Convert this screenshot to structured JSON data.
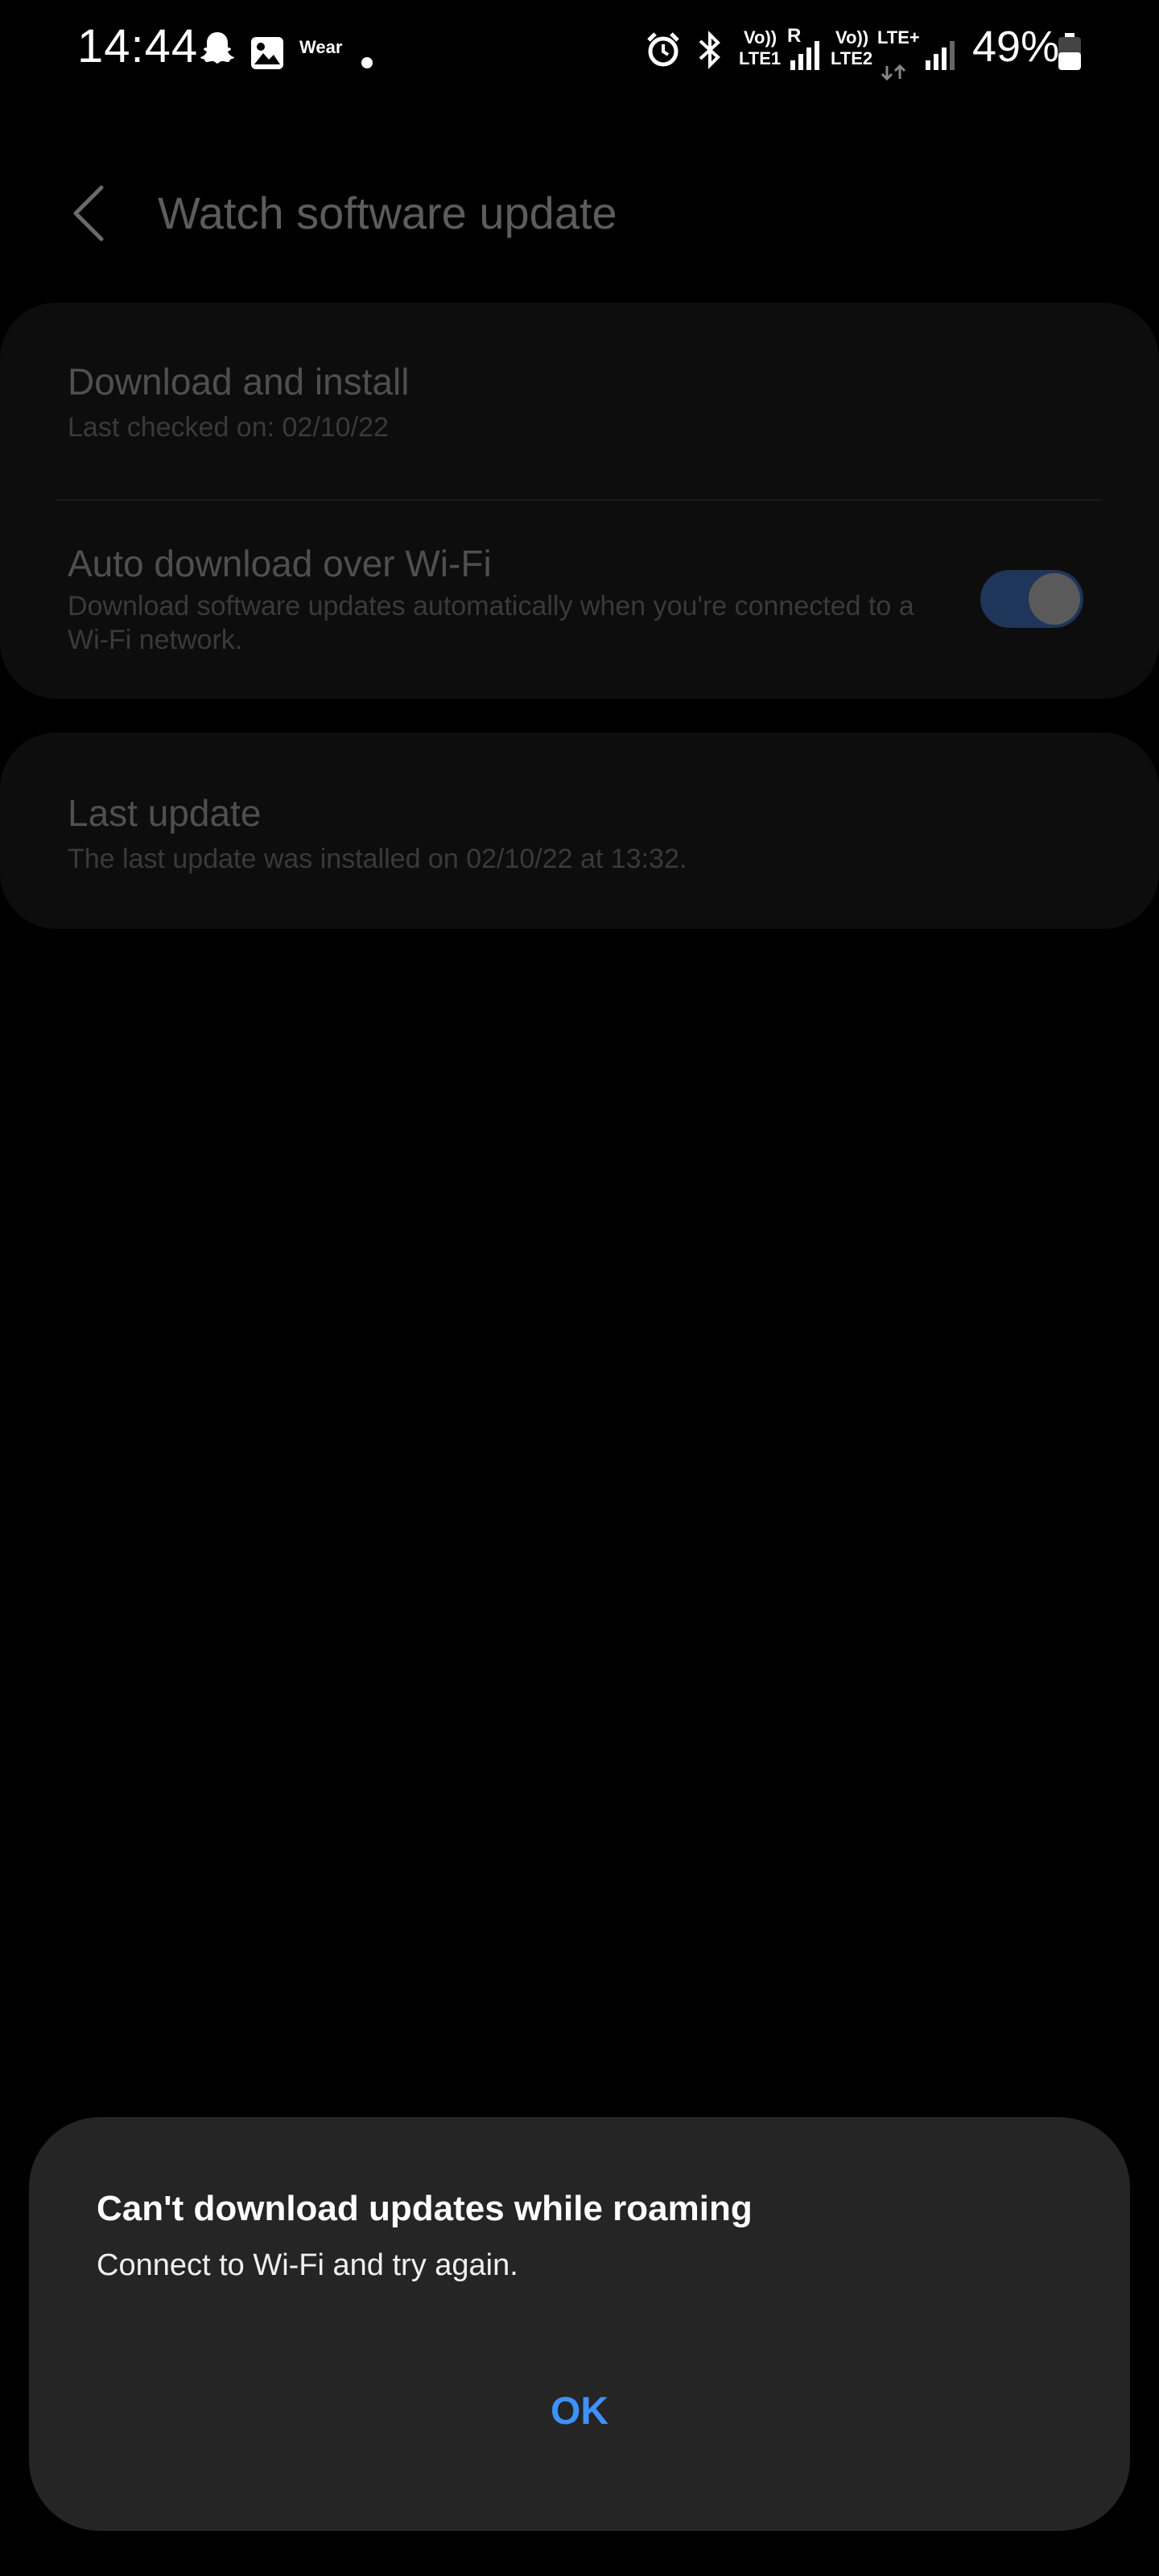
{
  "status_bar": {
    "time": "14:44",
    "wear_label": "Wear",
    "volte1": "Vo))",
    "lte1": "LTE1",
    "roaming": "R",
    "volte2": "Vo))",
    "lte2": "LTE2",
    "lte_plus": "LTE+",
    "battery_percent": "49%",
    "icons": [
      "snapchat-icon",
      "gallery-icon",
      "dot-icon",
      "alarm-icon",
      "bluetooth-icon",
      "signal-icon",
      "battery-icon"
    ]
  },
  "header": {
    "back_icon": "chevron-left-icon",
    "title": "Watch software update"
  },
  "settings": {
    "download_install": {
      "title": "Download and install",
      "subtitle": "Last checked on: 02/10/22"
    },
    "auto_download": {
      "title": "Auto download over Wi-Fi",
      "subtitle": "Download software updates automatically when you're connected to a Wi-Fi network.",
      "enabled": true
    },
    "last_update": {
      "title": "Last update",
      "subtitle": "The last update was installed on 02/10/22 at 13:32."
    }
  },
  "dialog": {
    "title": "Can't download updates while roaming",
    "message": "Connect to Wi-Fi and try again.",
    "ok_label": "OK"
  },
  "colors": {
    "background": "#000000",
    "card": "#0d0d0d",
    "dialog": "#252525",
    "accent": "#3e91ff",
    "toggle_track": "#1f355a"
  }
}
